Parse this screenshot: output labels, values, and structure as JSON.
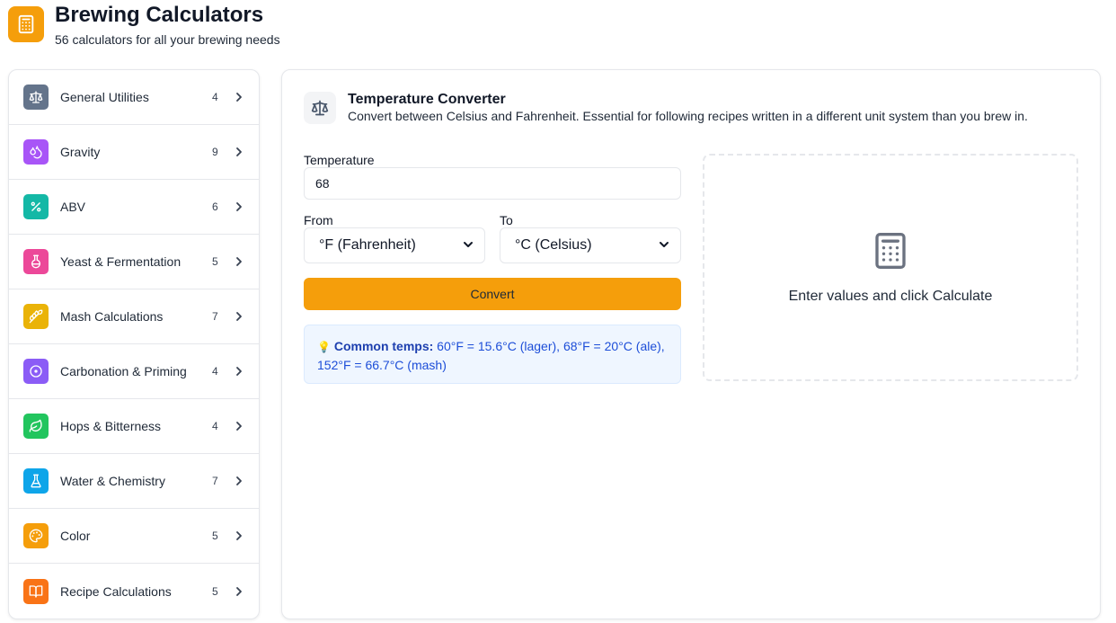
{
  "header": {
    "title": "Brewing Calculators",
    "subtitle": "56 calculators for all your brewing needs"
  },
  "sidebar": {
    "items": [
      {
        "label": "General Utilities",
        "count": "4",
        "color": "#64748b",
        "icon": "scale-icon"
      },
      {
        "label": "Gravity",
        "count": "9",
        "color": "#a855f7",
        "icon": "droplets-icon"
      },
      {
        "label": "ABV",
        "count": "6",
        "color": "#14b8a6",
        "icon": "percent-icon"
      },
      {
        "label": "Yeast & Fermentation",
        "count": "5",
        "color": "#ec4899",
        "icon": "flask-round-icon"
      },
      {
        "label": "Mash Calculations",
        "count": "7",
        "color": "#eab308",
        "icon": "wheat-icon"
      },
      {
        "label": "Carbonation & Priming",
        "count": "4",
        "color": "#8b5cf6",
        "icon": "circle-dot-icon"
      },
      {
        "label": "Hops & Bitterness",
        "count": "4",
        "color": "#22c55e",
        "icon": "leaf-icon"
      },
      {
        "label": "Water & Chemistry",
        "count": "7",
        "color": "#0ea5e9",
        "icon": "flask-conical-icon"
      },
      {
        "label": "Color",
        "count": "5",
        "color": "#f59e0b",
        "icon": "palette-icon"
      },
      {
        "label": "Recipe Calculations",
        "count": "5",
        "color": "#f97316",
        "icon": "book-open-icon"
      }
    ]
  },
  "calculator": {
    "title": "Temperature Converter",
    "description": "Convert between Celsius and Fahrenheit. Essential for following recipes written in a different unit system than you brew in.",
    "temperature_label": "Temperature",
    "temperature_value": "68",
    "from_label": "From",
    "from_value": "°F (Fahrenheit)",
    "to_label": "To",
    "to_value": "°C (Celsius)",
    "convert_label": "Convert",
    "tip_emoji": "💡",
    "tip_bold": "Common temps:",
    "tip_text": " 60°F = 15.6°C (lager), 68°F = 20°C (ale), 152°F = 66.7°C (mash)"
  },
  "result": {
    "placeholder": "Enter values and click Calculate"
  },
  "colors": {
    "accent": "#f59e0b",
    "tip_background": "#eff6ff",
    "tip_text": "#1d4ed8"
  }
}
